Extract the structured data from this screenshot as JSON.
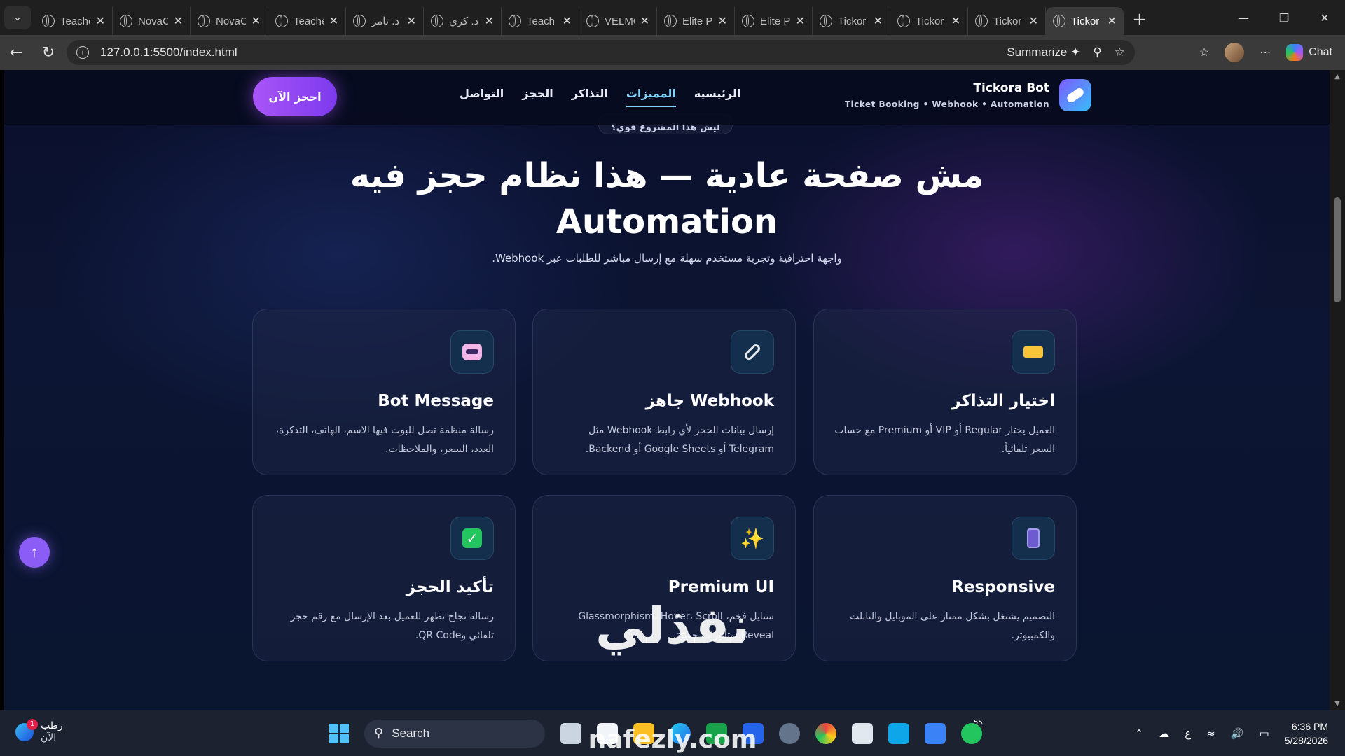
{
  "browser": {
    "tabs": [
      {
        "label": "Teache"
      },
      {
        "label": "NovaC"
      },
      {
        "label": "NovaC"
      },
      {
        "label": "Teache"
      },
      {
        "label": "د. تامر"
      },
      {
        "label": "د. كري"
      },
      {
        "label": "Teach"
      },
      {
        "label": "VELMO"
      },
      {
        "label": "Elite Pr"
      },
      {
        "label": "Elite Pr"
      },
      {
        "label": "Tickor"
      },
      {
        "label": "Tickor"
      },
      {
        "label": "Tickor"
      },
      {
        "label": "Tickor",
        "active": true
      }
    ],
    "url": "127.0.0.1:5500/index.html",
    "summarize_label": "Summarize",
    "chat_label": "Chat"
  },
  "site": {
    "brand_name": "Tickora Bot",
    "brand_tagline": "Ticket Booking • Webhook • Automation",
    "nav": [
      {
        "label": "الرئيسية",
        "active": false
      },
      {
        "label": "المميزات",
        "active": true
      },
      {
        "label": "التذاكر",
        "active": false
      },
      {
        "label": "الحجز",
        "active": false
      },
      {
        "label": "التواصل",
        "active": false
      }
    ],
    "cta_label": "احجز الآن",
    "pill_text": "ليش هذا المشروع قوي؟",
    "hero_title": "مش صفحة عادية — هذا نظام حجز فيه Automation",
    "hero_subtitle": "واجهة احترافية وتجربة مستخدم سهلة مع إرسال مباشر للطلبات عبر Webhook.",
    "features": [
      {
        "icon": "ticket-icon",
        "title": "اختيار التذاكر",
        "desc": "العميل يختار Regular أو VIP أو Premium مع حساب السعر تلقائياً."
      },
      {
        "icon": "link-icon",
        "title": "Webhook جاهز",
        "desc": "إرسال بيانات الحجز لأي رابط Webhook مثل Telegram أو Google Sheets أو Backend."
      },
      {
        "icon": "robot-icon",
        "title": "Bot Message",
        "desc": "رسالة منظمة تصل للبوت فيها الاسم، الهاتف، التذكرة، العدد، السعر، والملاحظات."
      },
      {
        "icon": "phone-icon",
        "title": "Responsive",
        "desc": "التصميم يشتغل بشكل ممتاز على الموبايل والتابلت والكمبيوتر."
      },
      {
        "icon": "sparkles-icon",
        "title": "Premium UI",
        "desc": "ستايل فخم، Glassmorphism، Hover، Scroll Reveal، وتأثيرات حديثة."
      },
      {
        "icon": "check-icon",
        "title": "تأكيد الحجز",
        "desc": "رسالة نجاح تظهر للعميل بعد الإرسال مع رقم حجز تلقائي وQR Code."
      }
    ],
    "scroll_top_label": "↑"
  },
  "watermark": {
    "text": "نفذلي",
    "url": "nafezly.com"
  },
  "taskbar": {
    "weather_title": "رطب",
    "weather_sub": "الآن",
    "weather_badge": "1",
    "search_label": "Search",
    "whatsapp_badge": "55",
    "lang": "ع",
    "time": "6:36 PM",
    "date": "5/28/2026"
  }
}
